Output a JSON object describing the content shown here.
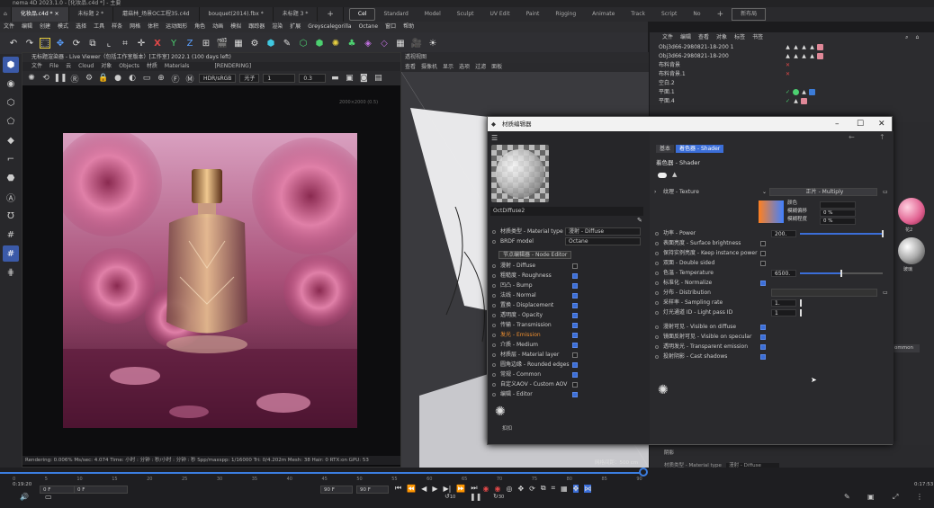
{
  "window": {
    "title": "nema 4D 2023.1.0 - [化妆品.c4d *] - 主要"
  },
  "tabs": [
    {
      "label": "化妆品.c4d *",
      "active": true
    },
    {
      "label": "未标题 2 *",
      "active": false
    },
    {
      "label": "蘑菇林_场景OC工程35.c4d",
      "active": false
    },
    {
      "label": "bouquet(2014).fbx *",
      "active": false
    },
    {
      "label": "未标题 3 *",
      "active": false
    }
  ],
  "layout_tabs": [
    "Cel",
    "Standard",
    "Model",
    "Sculpt",
    "UV Edit",
    "Paint",
    "Rigging",
    "Animate",
    "Track",
    "Script",
    "No"
  ],
  "layout_active": "Cel",
  "new_layout_label": "新布局",
  "menubar": [
    "文件",
    "编辑",
    "创建",
    "模式",
    "选择",
    "工具",
    "样条",
    "网格",
    "体积",
    "运动图形",
    "角色",
    "动画",
    "模拟",
    "跟踪器",
    "渲染",
    "扩展",
    "Greyscalegorilla",
    "Octane",
    "窗口",
    "帮助"
  ],
  "live_viewer": {
    "title": "无标题渲染器 - Live Viewer（包括工作室版本）[工作室] 2022.1 (100 days left)",
    "menu": [
      "文件",
      "File",
      "云",
      "Cloud",
      "对象",
      "Objects",
      "材质",
      "Materials"
    ],
    "rendering_label": "[RENDERING]",
    "color_space": "HDR/sRGB",
    "mode": "光子",
    "field1": "1",
    "field2": "0.3",
    "resolution_hint": "2000×2000 (0.5)",
    "status": "Rendering: 0.006%  Ms/sec: 4.074   Time: 小时 : 分钟 : 秒/小时 : 分钟 : 秒   Spp/maxspp: 1/16000   Tri: 0/4.202m  Mesh: 38   Hair: 0   RTX:on     GPU: 53"
  },
  "viewport": {
    "head": "透视视图",
    "menu": [
      "查看",
      "摄像机",
      "显示",
      "选项",
      "过滤",
      "面板"
    ],
    "grid_label": "网格间距：500 cm"
  },
  "object_manager": {
    "menu": [
      "文件",
      "编辑",
      "查看",
      "对象",
      "标签",
      "书签"
    ],
    "rows": [
      {
        "name": "Obj3d66-2980821-18-200 1",
        "tags": [
          "tri",
          "tri",
          "tri",
          "tri",
          "pink"
        ]
      },
      {
        "name": "Obj3d66-2980821-18-200",
        "tags": [
          "tri",
          "tri",
          "tri",
          "tri",
          "pink"
        ]
      },
      {
        "name": "布料背景",
        "tags": [
          "x"
        ]
      },
      {
        "name": "布料背景.1",
        "tags": [
          "x"
        ]
      },
      {
        "name": "空白.2",
        "tags": []
      },
      {
        "name": "平面.1",
        "tags": [
          "check",
          "green",
          "tri",
          "blue"
        ]
      },
      {
        "name": "平面.4",
        "tags": [
          "check",
          "tri",
          "pink"
        ]
      }
    ]
  },
  "material_editor": {
    "title": "材质编辑器",
    "material_name": "OctDiffuse2",
    "left_props": [
      {
        "label": "材质类型 - Material type",
        "value": "漫射 - Diffuse",
        "kind": "select"
      },
      {
        "label": "BRDF model",
        "value": "Octane",
        "kind": "select"
      }
    ],
    "node_editor_button": "节点编辑器 - Node Editor",
    "channels": [
      {
        "label": "漫射 - Diffuse",
        "on": false,
        "active": false
      },
      {
        "label": "粗糙度 - Roughness",
        "on": true,
        "active": false
      },
      {
        "label": "凹凸 - Bump",
        "on": true,
        "active": false
      },
      {
        "label": "法线 - Normal",
        "on": true,
        "active": false
      },
      {
        "label": "置换 - Displacement",
        "on": true,
        "active": false
      },
      {
        "label": "透明度 - Opacity",
        "on": true,
        "active": false
      },
      {
        "label": "传输 - Transmission",
        "on": true,
        "active": false
      },
      {
        "label": "发光 - Emission",
        "on": true,
        "active": true
      },
      {
        "label": "介质 - Medium",
        "on": true,
        "active": false
      },
      {
        "label": "材质层 - Material layer",
        "on": false,
        "active": false
      },
      {
        "label": "圆角边缘 - Rounded edges",
        "on": true,
        "active": false
      },
      {
        "label": "常规 - Common",
        "on": true,
        "active": false
      },
      {
        "label": "自定义AOV - Custom AOV",
        "on": false,
        "active": false
      },
      {
        "label": "编辑 - Editor",
        "on": true,
        "active": false
      }
    ],
    "logo_label": "扣扣",
    "right_tabs": [
      "基本",
      "着色器 - Shader"
    ],
    "right_section_title": "着色器 - Shader",
    "texture_label": "纹理 - Texture",
    "texture_blend": "正片 - Multiply",
    "gradient_sub": [
      {
        "label": "颜色",
        "value": ""
      },
      {
        "label": "模糊偏移",
        "value": "0 %"
      },
      {
        "label": "模糊程度",
        "value": "0 %"
      }
    ],
    "props": [
      {
        "label": "功率 - Power",
        "value": "200.",
        "fill": 1.0
      },
      {
        "label": "表面亮度 - Surface brightness",
        "checkbox": false
      },
      {
        "label": "保持实例亮度 - Keep instance power",
        "checkbox": false
      },
      {
        "label": "双面 - Double sided",
        "checkbox": false
      },
      {
        "label": "色温 - Temperature",
        "value": "6500.",
        "fill": 0.5
      },
      {
        "label": "标准化 - Normalize",
        "checkbox": true
      },
      {
        "label": "分布 - Distribution",
        "value": ""
      },
      {
        "label": "采样率 - Sampling rate",
        "value": "1."
      },
      {
        "label": "灯光通道 ID - Light pass ID",
        "value": "1"
      },
      {
        "label": "漫射可见 - Visible on diffuse",
        "checkbox": true
      },
      {
        "label": "镜面反射可见 - Visible on specular",
        "checkbox": true
      },
      {
        "label": "透明发光 - Transparent emission",
        "checkbox": true
      },
      {
        "label": "投射阴影 - Cast shadows",
        "checkbox": true
      }
    ]
  },
  "right_side": {
    "labels": [
      "花2",
      "玻璃"
    ],
    "button": "ommon"
  },
  "attr_bottom": {
    "rows": [
      {
        "label": "阴影",
        "value": ""
      },
      {
        "label": "材质类型 - Material type",
        "value": "漫射 - Diffuse"
      },
      {
        "label": "BRDF model",
        "value": "Octane"
      },
      {
        "label": "节点编辑器 - Node Editor",
        "value": ""
      },
      {
        "label": "漫射 - Diffuse",
        "value": ""
      }
    ]
  },
  "timeline": {
    "current_time": "0:19:20",
    "total_time": "0:17:53",
    "ticks": [
      "0",
      "5",
      "10",
      "15",
      "20",
      "25",
      "30",
      "35",
      "40",
      "45",
      "50",
      "55",
      "60",
      "65",
      "70",
      "75",
      "80",
      "85",
      "90"
    ],
    "field_start": "0 F",
    "field_cur": "0 F",
    "field_end": "90 F",
    "field_end2": "90 F",
    "skip_back": "10",
    "skip_fwd": "30"
  }
}
